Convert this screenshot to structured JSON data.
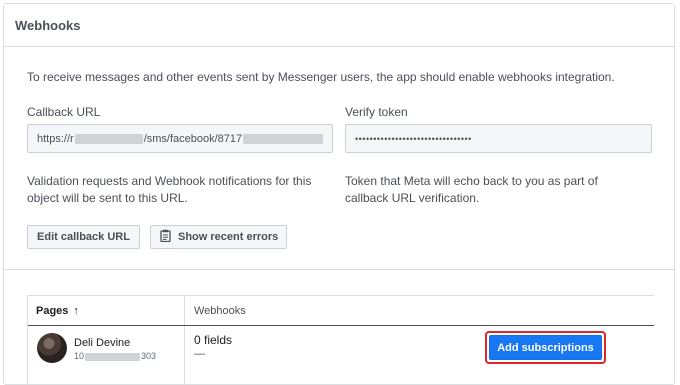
{
  "panel": {
    "title": "Webhooks"
  },
  "intro": "To receive messages and other events sent by Messenger users, the app should enable webhooks integration.",
  "callback": {
    "label": "Callback URL",
    "value_prefix": "https://r",
    "value_middle": "/sms/facebook/8717",
    "description_line1": "Validation requests and Webhook notifications for this",
    "description_line2": "object will be sent to this URL."
  },
  "verify": {
    "label": "Verify token",
    "value": "••••••••••••••••••••••••••••••••",
    "description_line1": "Token that Meta will echo back to you as part of",
    "description_line2": "callback URL verification."
  },
  "buttons": {
    "edit_callback": "Edit callback URL",
    "show_errors": "Show recent errors"
  },
  "table": {
    "headers": {
      "pages": "Pages",
      "sort_arrow": "↑",
      "webhooks": "Webhooks"
    },
    "rows": [
      {
        "page_name": "Deli Devine",
        "page_id_prefix": "10",
        "page_id_suffix": "303",
        "fields": "0 fields",
        "dash": "—",
        "action": "Add subscriptions"
      }
    ]
  },
  "colors": {
    "primary": "#1877f2",
    "highlight": "#e0252a"
  }
}
